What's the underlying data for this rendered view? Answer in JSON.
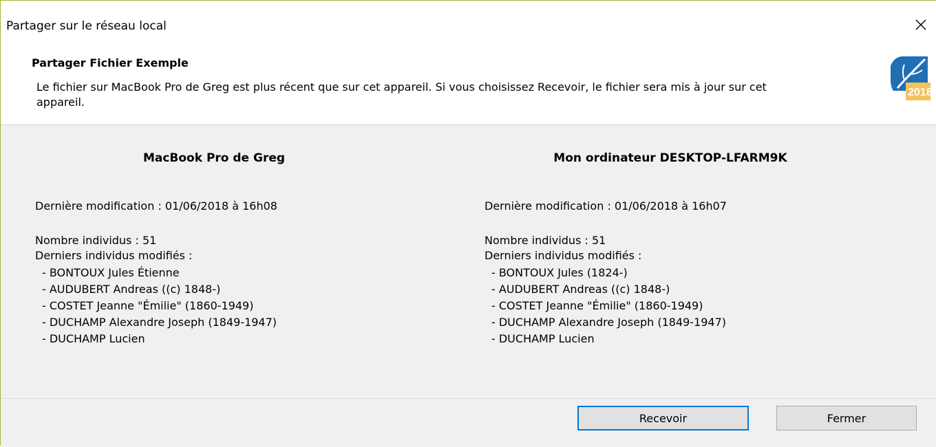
{
  "window": {
    "title": "Partager sur le réseau local",
    "close_glyph": "✕"
  },
  "header": {
    "title": "Partager Fichier Exemple",
    "description": "Le fichier sur MacBook Pro de Greg est plus récent que sur cet appareil. Si vous choisissez Recevoir, le fichier sera mis à jour sur cet appareil.",
    "logo_text": "2018",
    "logo_icon": "leaf-app-icon",
    "accent_color": "#1f6fb5"
  },
  "devices": [
    {
      "name": "MacBook Pro de Greg",
      "last_modified": "Dernière modification : 01/06/2018 à 16h08",
      "count": "Nombre individus : 51",
      "recent_label": "Derniers individus modifiés :",
      "recent": [
        "- BONTOUX Jules Étienne",
        "- AUDUBERT Andreas ((c) 1848-)",
        "- COSTET Jeanne \"Émilie\" (1860-1949)",
        "- DUCHAMP Alexandre Joseph (1849-1947)",
        "- DUCHAMP Lucien"
      ]
    },
    {
      "name": "Mon ordinateur DESKTOP-LFARM9K",
      "last_modified": "Dernière modification : 01/06/2018 à 16h07",
      "count": "Nombre individus : 51",
      "recent_label": "Derniers individus modifiés :",
      "recent": [
        "- BONTOUX Jules (1824-)",
        "- AUDUBERT Andreas ((c) 1848-)",
        "- COSTET Jeanne \"Émilie\" (1860-1949)",
        "- DUCHAMP Alexandre Joseph (1849-1947)",
        "- DUCHAMP Lucien"
      ]
    }
  ],
  "buttons": {
    "receive": "Recevoir",
    "close": "Fermer",
    "default_border_color": "#0078d7"
  }
}
